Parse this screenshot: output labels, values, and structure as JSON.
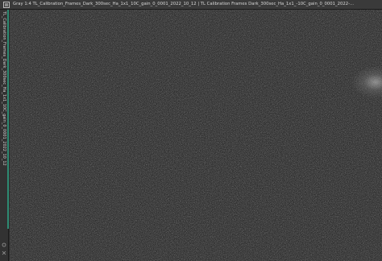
{
  "window": {
    "title": "Gray 1:4 TL_Calibration_Frames_Dark_300sec_Ha_1x1_10C_gain_0_0001_2022_10_12 | TL Calibration Frames Dark_300sec_Ha_1x1_-10C_gain_0_0001_2022-...",
    "side_tab_label": "TL_Calibration_Frames_Dark_300sec_Ha_1x1_10C_gain_0_0001_2022_10_12",
    "icon": "image-window-icon"
  },
  "image": {
    "description_color": "#2b2b2b",
    "accent_color": "#2e8a72"
  }
}
